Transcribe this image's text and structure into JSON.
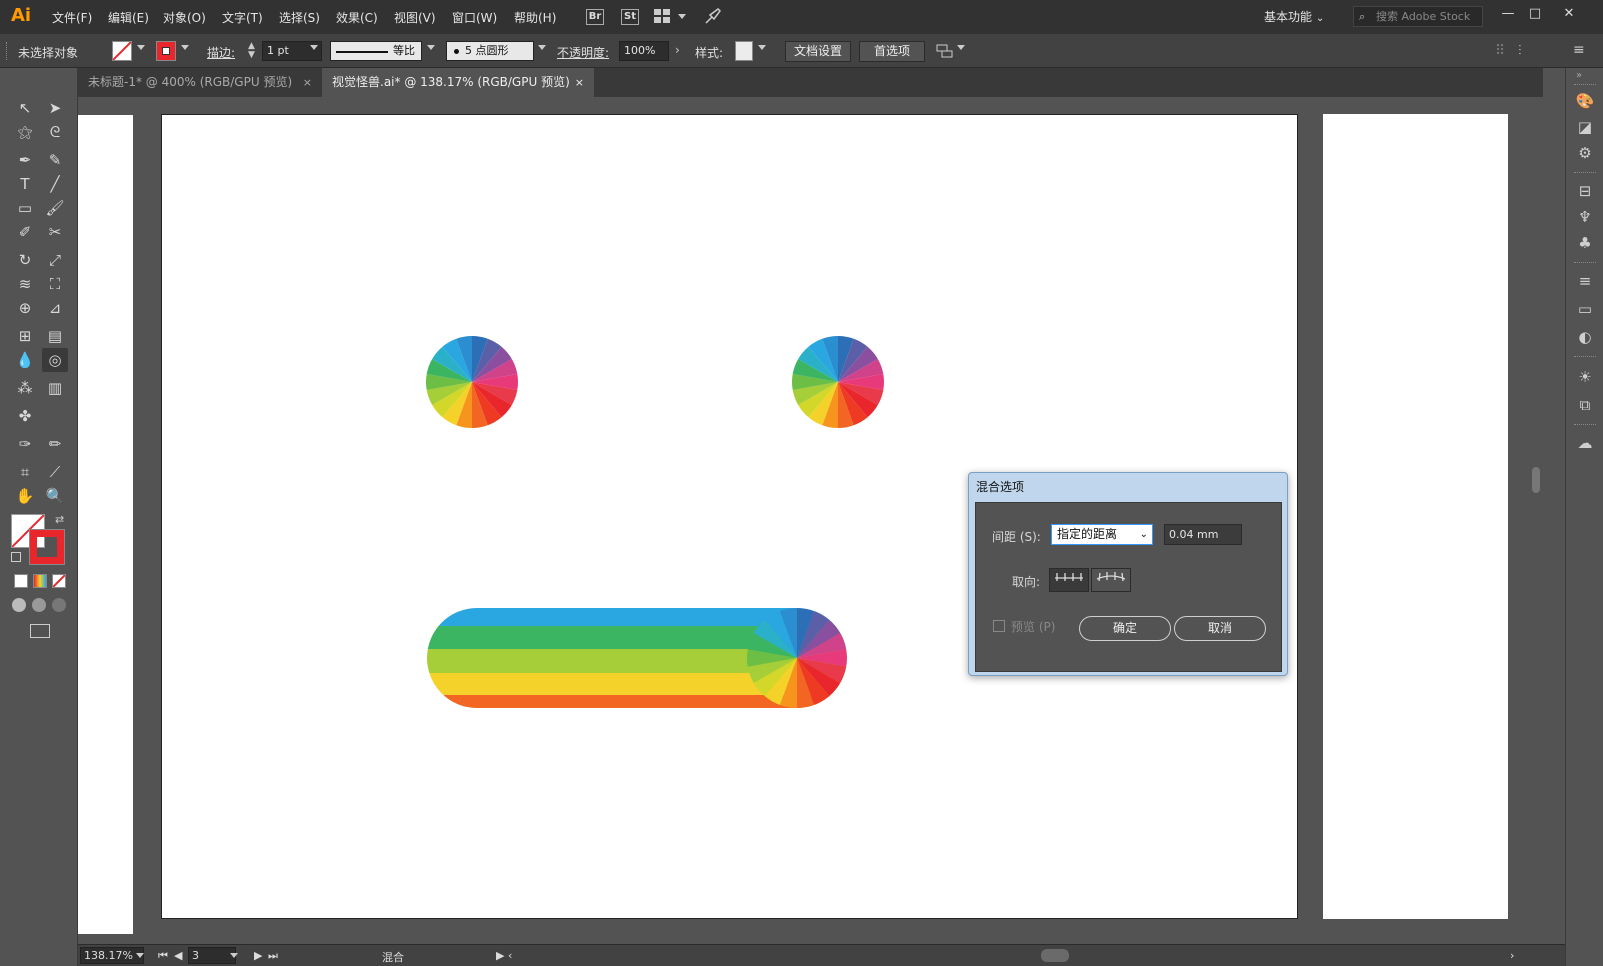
{
  "app": {
    "logo": "Ai"
  },
  "menu": [
    "文件(F)",
    "编辑(E)",
    "对象(O)",
    "文字(T)",
    "选择(S)",
    "效果(C)",
    "视图(V)",
    "窗口(W)",
    "帮助(H)"
  ],
  "menu_chips": {
    "bridge": "Br",
    "stock": "St"
  },
  "workspace": "基本功能",
  "search": {
    "placeholder": "搜索 Adobe Stock"
  },
  "window_controls": {
    "minimize": "—",
    "maximize": "□",
    "close": "✕"
  },
  "control_bar": {
    "selection_status": "未选择对象",
    "stroke_label": "描边:",
    "stroke_weight": "1 pt",
    "stroke_profile": "等比",
    "brush": "5 点圆形",
    "opacity_label": "不透明度:",
    "opacity_value": "100%",
    "style_label": "样式:",
    "doc_setup_button": "文档设置",
    "preferences_button": "首选项"
  },
  "tabs": [
    {
      "label": "未标题-1* @ 400% (RGB/GPU 预览)",
      "active": false
    },
    {
      "label": "视觉怪兽.ai* @ 138.17% (RGB/GPU 预览)",
      "active": true
    }
  ],
  "tab_close": "×",
  "status_bar": {
    "zoom": "138.17%",
    "artboard_number": "3",
    "tool_name": "混合"
  },
  "dialog": {
    "title": "混合选项",
    "spacing_label": "间距 (S):",
    "spacing_option": "指定的距离",
    "spacing_value": "0.04 mm",
    "orientation_label": "取向:",
    "preview_label": "预览 (P)",
    "ok_button": "确定",
    "cancel_button": "取消"
  },
  "colors": {
    "blue": "#2aa6e0",
    "green": "#3cb562",
    "lime": "#a6ce39",
    "yellow": "#f4d22a",
    "orange": "#f26522",
    "red": "#e8262b",
    "pink": "#e8397a",
    "purple": "#8a4f9e",
    "navy": "#2c6fb7",
    "stroke_red": "#e8262b"
  },
  "wheel_slice_colors": [
    "#2c6fb7",
    "#5a5fa8",
    "#8a4f9e",
    "#d0428a",
    "#e8397a",
    "#e83a4a",
    "#e8262b",
    "#ee3a23",
    "#f26522",
    "#f7941d",
    "#f4d22a",
    "#d2d72a",
    "#a6ce39",
    "#6cbe45",
    "#3cb562",
    "#2ab1c9",
    "#2aa6e0",
    "#2a8ed0"
  ]
}
